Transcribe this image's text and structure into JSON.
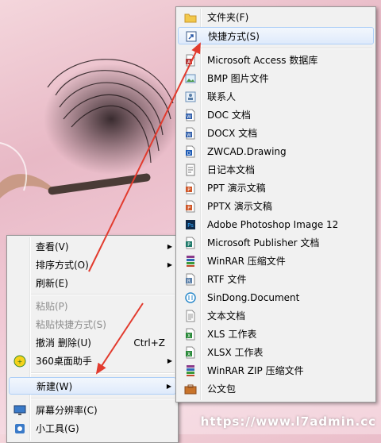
{
  "context_menu": {
    "items": [
      {
        "label": "查看(V)",
        "submenu": true
      },
      {
        "label": "排序方式(O)",
        "submenu": true
      },
      {
        "label": "刷新(E)"
      },
      {
        "label": "粘贴(P)",
        "disabled": true
      },
      {
        "label": "粘贴快捷方式(S)",
        "disabled": true
      },
      {
        "label": "撤消 删除(U)",
        "accel": "Ctrl+Z"
      },
      {
        "label": "360桌面助手",
        "submenu": true,
        "icon": "360-assistant-icon"
      },
      {
        "label": "新建(W)",
        "submenu": true,
        "highlighted": true
      },
      {
        "label": "屏幕分辨率(C)",
        "icon": "display-icon"
      },
      {
        "label": "小工具(G)",
        "icon": "gadget-icon"
      }
    ],
    "submenu_arrow": "▶"
  },
  "new_submenu": {
    "items": [
      {
        "label": "文件夹(F)",
        "icon": "folder-icon"
      },
      {
        "label": "快捷方式(S)",
        "icon": "shortcut-icon",
        "highlighted": true
      },
      {
        "label": "Microsoft Access 数据库",
        "icon": "access-icon"
      },
      {
        "label": "BMP 图片文件",
        "icon": "bmp-icon"
      },
      {
        "label": "联系人",
        "icon": "contact-icon"
      },
      {
        "label": "DOC 文档",
        "icon": "doc-icon"
      },
      {
        "label": "DOCX 文档",
        "icon": "docx-icon"
      },
      {
        "label": "ZWCAD.Drawing",
        "icon": "dwg-icon"
      },
      {
        "label": "日记本文档",
        "icon": "journal-icon"
      },
      {
        "label": "PPT 演示文稿",
        "icon": "ppt-icon"
      },
      {
        "label": "PPTX 演示文稿",
        "icon": "pptx-icon"
      },
      {
        "label": "Adobe Photoshop Image 12",
        "icon": "photoshop-icon"
      },
      {
        "label": "Microsoft Publisher 文档",
        "icon": "publisher-icon"
      },
      {
        "label": "WinRAR 压缩文件",
        "icon": "winrar-icon"
      },
      {
        "label": "RTF 文件",
        "icon": "rtf-icon"
      },
      {
        "label": "SinDong.Document",
        "icon": "sindong-icon"
      },
      {
        "label": "文本文档",
        "icon": "text-icon"
      },
      {
        "label": "XLS 工作表",
        "icon": "xls-icon"
      },
      {
        "label": "XLSX 工作表",
        "icon": "xlsx-icon"
      },
      {
        "label": "WinRAR ZIP 压缩文件",
        "icon": "winrar-zip-icon"
      },
      {
        "label": "公文包",
        "icon": "briefcase-icon"
      }
    ]
  },
  "watermark": "https://www.l7admin.cc",
  "colors": {
    "arrow": "#e23b2e",
    "highlight_border": "#aecff7",
    "menu_bg": "#f1f1f1"
  }
}
